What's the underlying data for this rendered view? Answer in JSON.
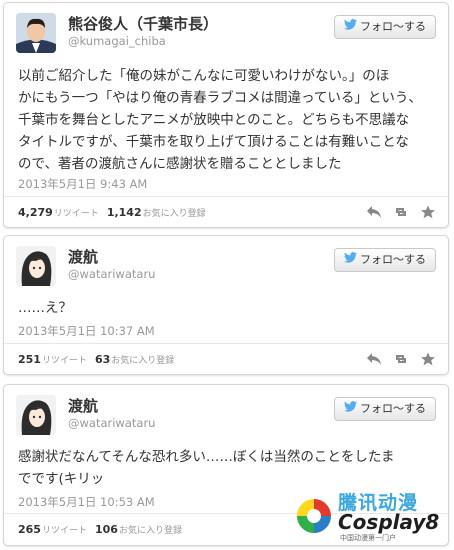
{
  "follow_label": "フォロ～する",
  "tweets": [
    {
      "name": "熊谷俊人（千葉市長）",
      "handle": "@kumagai_chiba",
      "text": "以前ご紹介した「俺の妹がこんなに可愛いわけがない。」のほ\nかにもう一つ「やはり俺の青春ラブコメは間違っている」という、\n千葉市を舞台としたアニメが放映中とのこと。どちらも不思議な\nタイトルですが、千葉市を取り上げて頂けることは有難いことな\nので、著者の渡航さんに感謝状を贈ることとしました",
      "time": "2013年5月1日 9:43 AM",
      "retweets": "4,279",
      "retweets_label": "リツイート",
      "favorites": "1,142",
      "favorites_label": "お気に入り登録"
    },
    {
      "name": "渡航",
      "handle": "@watariwataru",
      "text": "……え？",
      "time": "2013年5月1日 10:37 AM",
      "retweets": "251",
      "retweets_label": "リツイート",
      "favorites": "63",
      "favorites_label": "お気に入り登録"
    },
    {
      "name": "渡航",
      "handle": "@watariwataru",
      "text": "感謝状だなんてそんな恐れ多い……ぼくは当然のことをしたま\nでです(キリッ",
      "time": "2013年5月1日 10:53 AM",
      "retweets": "265",
      "retweets_label": "リツイート",
      "favorites": "106",
      "favorites_label": "お気に入り登録"
    }
  ],
  "icons": [
    "twitter-bird-icon",
    "reply-icon",
    "retweet-icon",
    "favorite-star-icon"
  ],
  "colors": {
    "twitter_blue": "#55acee",
    "muted": "#999999",
    "text": "#333333"
  },
  "watermark": {
    "line1": "騰讯动漫",
    "line2": "Cosplay8",
    "line3": "中国动漫第一门户"
  }
}
